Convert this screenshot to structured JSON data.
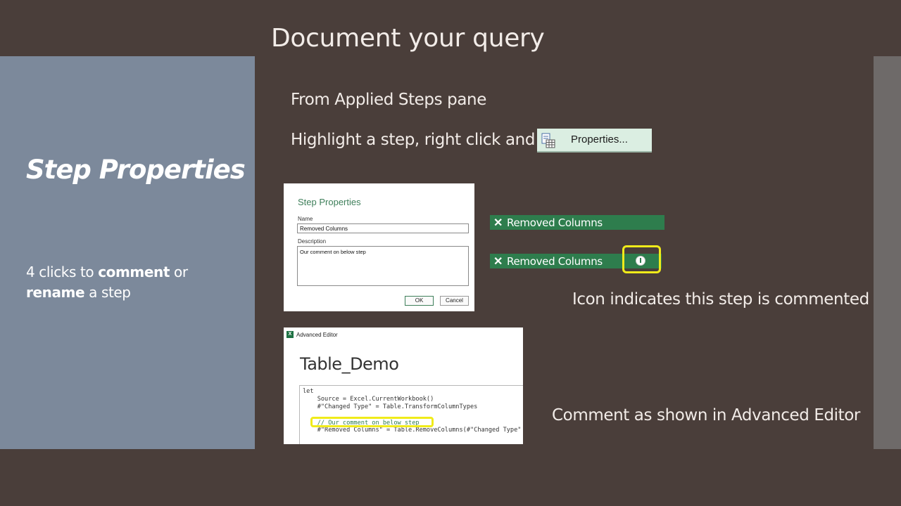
{
  "slide": {
    "title": "Document your query",
    "section_title": "Step Properties",
    "left_text_parts": [
      "4 clicks to ",
      "comment",
      " or ",
      "rename",
      " a step"
    ],
    "line_applied_steps": "From Applied Steps pane",
    "line_highlight": "Highlight a step, right click and",
    "caption_icon": "Icon indicates this step is commented",
    "caption_editor": "Comment as shown in Advanced Editor"
  },
  "properties_menu": {
    "icon": "properties-icon",
    "label": "Properties..."
  },
  "dialog": {
    "title": "Step Properties",
    "name_label": "Name",
    "name_value": "Removed Columns",
    "description_label": "Description",
    "description_value": "Our comment on below step",
    "ok_label": "OK",
    "cancel_label": "Cancel"
  },
  "steps": [
    {
      "icon": "x-icon",
      "label": "Removed Columns"
    },
    {
      "icon": "x-icon",
      "label": "Removed Columns",
      "badge_icon": "info-icon"
    }
  ],
  "advanced_editor": {
    "window_caption": "Advanced Editor",
    "query_name": "Table_Demo",
    "code_lines": [
      "let",
      "    Source = Excel.CurrentWorkbook()",
      "    #\"Changed Type\" = Table.TransformColumnTypes",
      "",
      "    // Our comment on below step",
      "    #\"Removed Columns\" = Table.RemoveColumns(#\"Changed Type\""
    ]
  },
  "colors": {
    "background": "#4a3e3a",
    "left_panel": "#7c899b",
    "step_green": "#2e7d4d",
    "highlight_yellow": "#f0eb1a"
  }
}
